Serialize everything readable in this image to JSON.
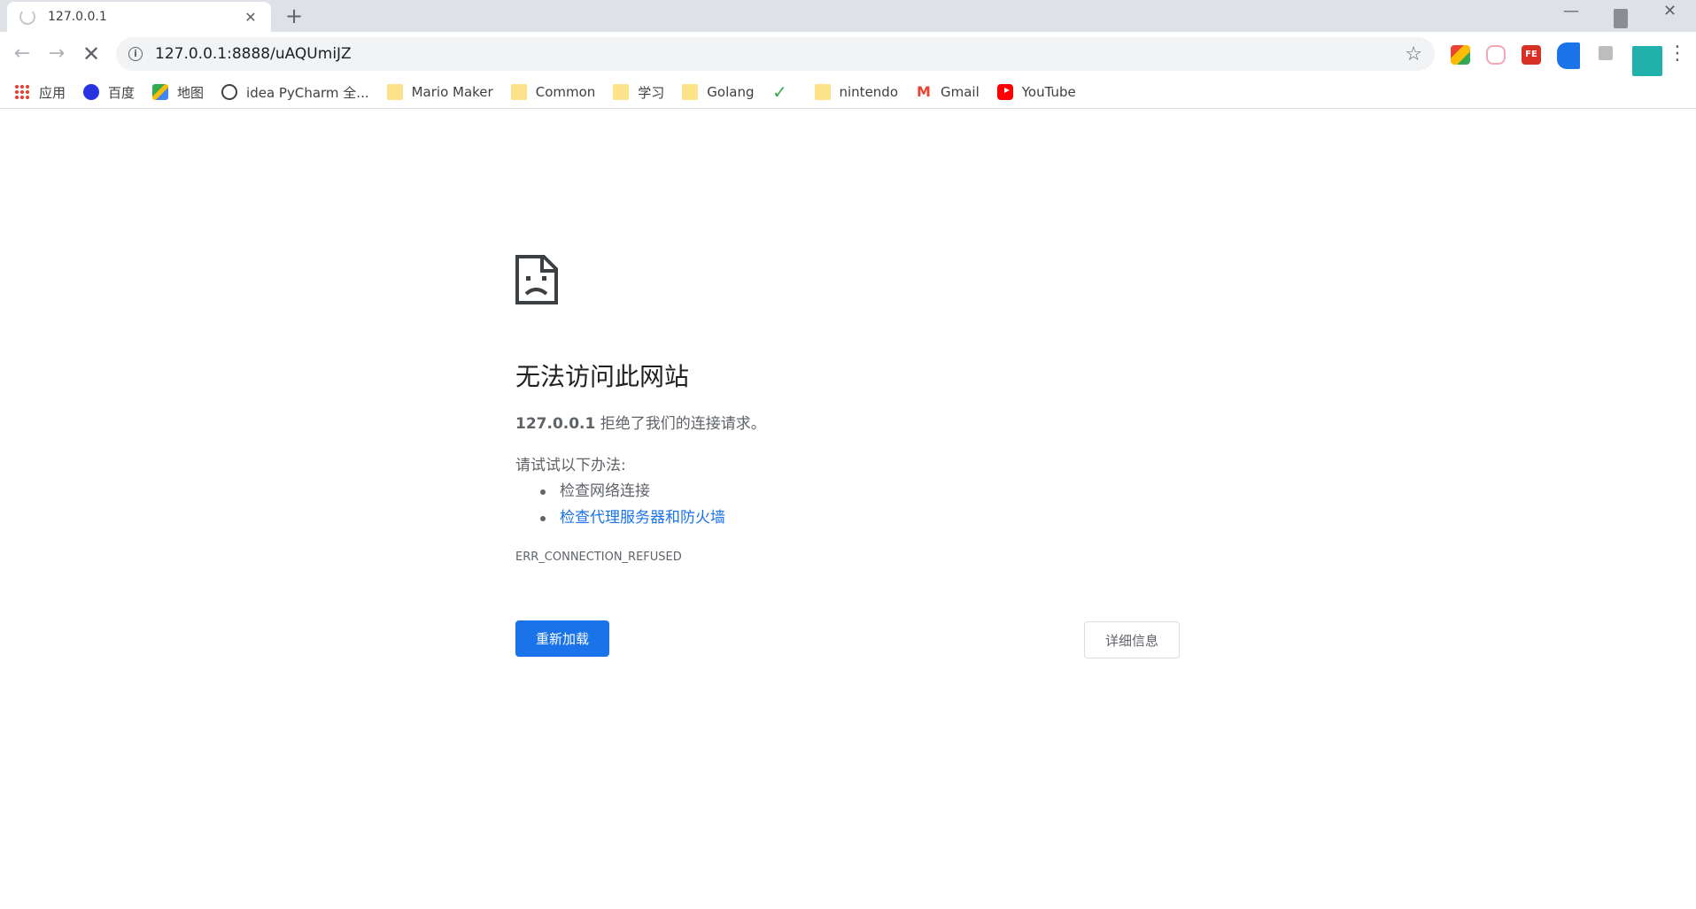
{
  "tab": {
    "title": "127.0.0.1",
    "close_symbol": "✕"
  },
  "new_tab_symbol": "+",
  "window_controls": {
    "minimize": "—",
    "close": "✕"
  },
  "toolbar": {
    "back_symbol": "←",
    "forward_symbol": "→",
    "stop_symbol": "✕",
    "url": "127.0.0.1:8888/uAQUmiJZ",
    "info_symbol": "i",
    "star_symbol": "☆",
    "ext3_label": "FE",
    "menu_symbol": "⋮"
  },
  "bookmarks": [
    {
      "label": "应用",
      "icon": "apps-icon"
    },
    {
      "label": "百度",
      "icon": "baidu-icon"
    },
    {
      "label": "地图",
      "icon": "maps-icon"
    },
    {
      "label": "idea PyCharm 全...",
      "icon": "globe-icon"
    },
    {
      "label": "Mario Maker",
      "icon": "folder-icon"
    },
    {
      "label": "Common",
      "icon": "folder-icon"
    },
    {
      "label": "学习",
      "icon": "folder-icon"
    },
    {
      "label": "Golang",
      "icon": "folder-icon"
    },
    {
      "label": "",
      "icon": "hao-check-icon"
    },
    {
      "label": "nintendo",
      "icon": "folder-icon"
    },
    {
      "label": "Gmail",
      "icon": "gmail-icon"
    },
    {
      "label": "YouTube",
      "icon": "youtube-icon"
    }
  ],
  "error": {
    "heading": "无法访问此网站",
    "host": "127.0.0.1",
    "message": " 拒绝了我们的连接请求。",
    "try_label": "请试试以下办法:",
    "suggestions": [
      "检查网络连接",
      "检查代理服务器和防火墙"
    ],
    "code": "ERR_CONNECTION_REFUSED",
    "reload_label": "重新加载",
    "details_label": "详细信息"
  },
  "colors": {
    "accent": "#1a73e8",
    "tabstrip": "#dee1e6",
    "text": "#5f6368"
  },
  "check_symbol": "✓",
  "gmail_symbol": "M"
}
